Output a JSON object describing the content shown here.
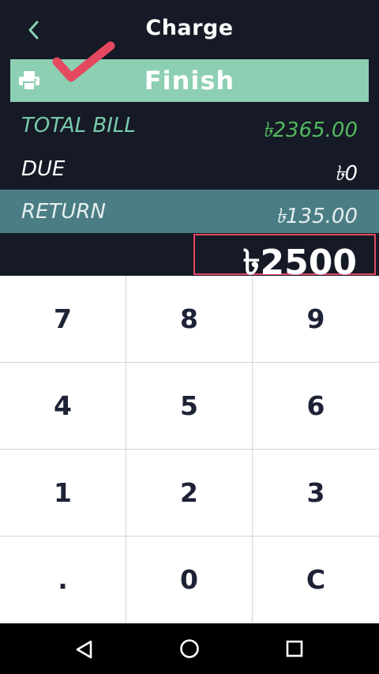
{
  "header": {
    "title": "Charge",
    "back_icon": "chevron-left-icon",
    "back_color": "#8ccfb3"
  },
  "finish": {
    "label": "Finish",
    "icon": "printer-icon",
    "bg_color": "#8ccfb3",
    "check_icon": "checkmark-icon",
    "check_color": "#e5485f"
  },
  "summary": {
    "total_label": "TOTAL  BILL",
    "total_value": "৳2365.00",
    "due_label": "DUE",
    "due_value": "৳0",
    "return_label": "RETURN",
    "return_value": "৳135.00"
  },
  "amount": {
    "value": "৳2500",
    "border_color": "#e5485f"
  },
  "keypad": {
    "keys": [
      "7",
      "8",
      "9",
      "4",
      "5",
      "6",
      "1",
      "2",
      "3",
      ".",
      "0",
      "C"
    ]
  },
  "navbar": {
    "icons": [
      "back-triangle-icon",
      "home-circle-icon",
      "recents-square-icon"
    ]
  }
}
